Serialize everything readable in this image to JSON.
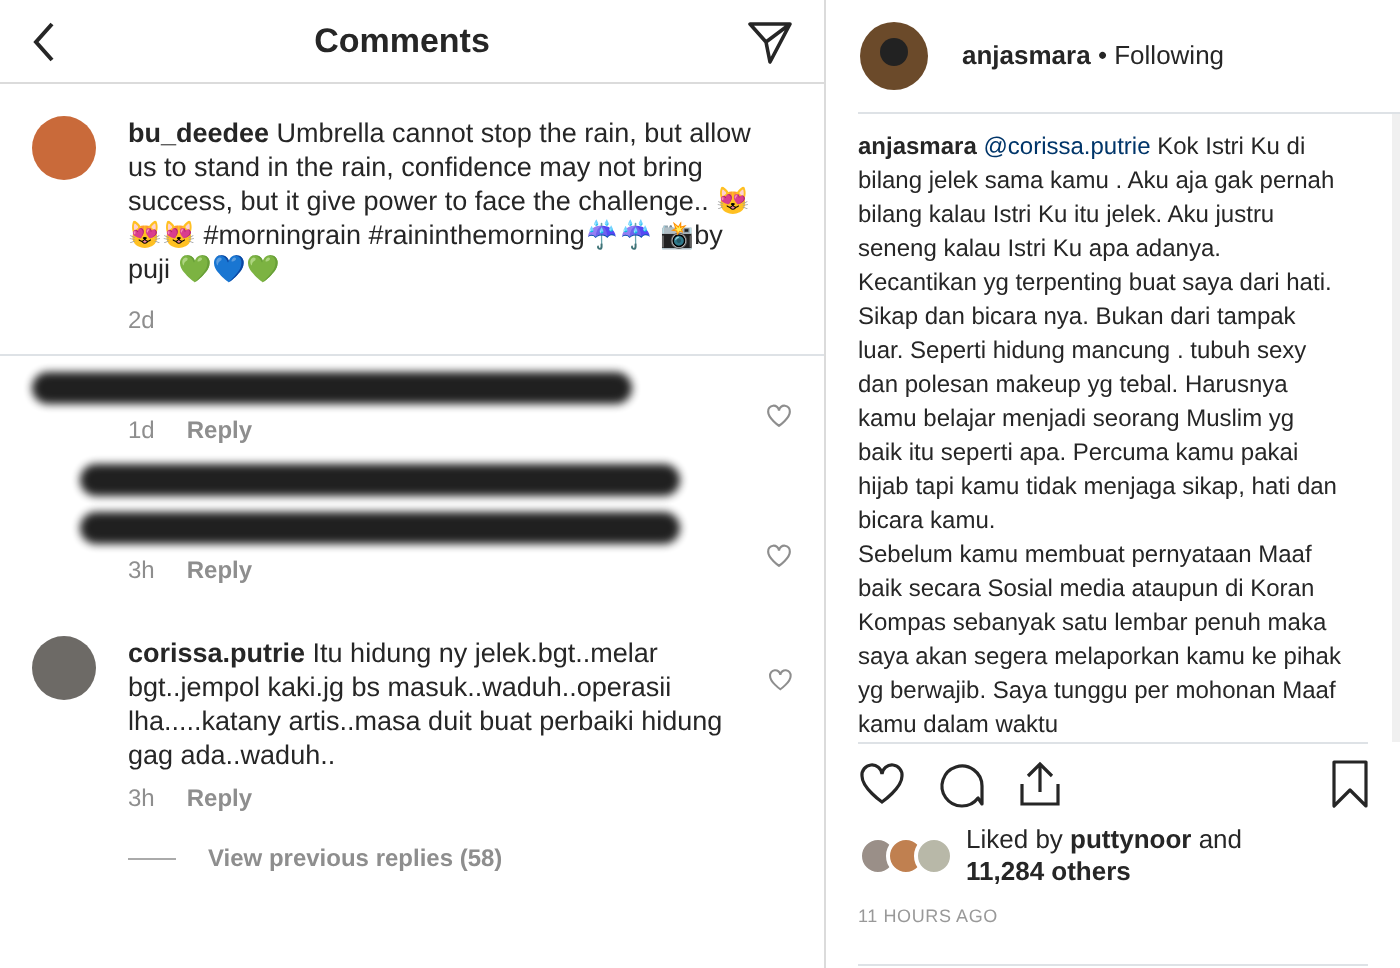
{
  "comments_panel": {
    "title": "Comments",
    "caption": {
      "user": "bu_deedee",
      "text": "Umbrella cannot stop the rain, but allow us to stand in the rain, confidence may not bring success, but it give power to face the challenge.. 😻😻😻 #morningrain #raininthemorning☔☔ 📸by puji 💚💙💚",
      "time": "2d"
    },
    "comments": [
      {
        "kind": "redacted",
        "time": "1d",
        "reply": "Reply",
        "indent": false
      },
      {
        "kind": "redacted",
        "indent": true
      },
      {
        "kind": "redacted",
        "time": "3h",
        "reply": "Reply",
        "indent": true
      },
      {
        "kind": "comment",
        "user": "corissa.putrie",
        "text": "Itu hidung ny jelek.bgt..melar bgt..jempol kaki.jg bs masuk..waduh..operasii lha.....katany artis..masa duit buat perbaiki hidung gag ada..waduh..",
        "time": "3h",
        "reply": "Reply",
        "indent": false
      }
    ],
    "view_replies": "View previous replies (58)"
  },
  "post_panel": {
    "user": "anjasmara",
    "following": "• Following",
    "comment": {
      "user": "anjasmara",
      "mention": "@corissa.putrie",
      "text": "Kok Istri Ku di bilang jelek sama kamu . Aku aja gak pernah bilang kalau Istri Ku itu jelek. Aku justru seneng kalau Istri Ku apa adanya.\nKecantikan yg terpenting buat saya dari hati. Sikap dan bicara nya. Bukan dari tampak luar. Seperti hidung mancung . tubuh sexy dan polesan makeup yg tebal. Harusnya kamu belajar menjadi seorang Muslim yg baik itu seperti apa. Percuma kamu pakai hijab tapi kamu tidak menjaga sikap, hati dan bicara kamu.\nSebelum kamu membuat pernyataan Maaf baik secara Sosial media ataupun di Koran Kompas sebanyak satu lembar penuh maka saya akan segera melaporkan kamu ke pihak yg berwajib. Saya tunggu per mohonan Maaf kamu dalam waktu"
    },
    "likes": "Liked by **puttynoor** and **11,284 others**",
    "time": "11 HOURS AGO"
  }
}
